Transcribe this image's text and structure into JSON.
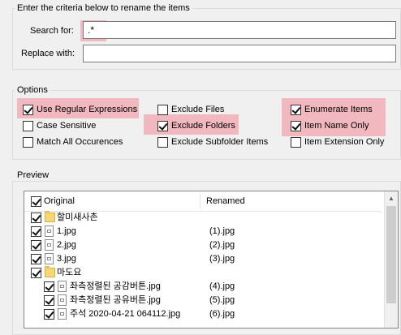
{
  "rename_criteria": {
    "title": "Enter the criteria below to rename the items",
    "search_label": "Search for:",
    "search_value": ".*",
    "replace_label": "Replace with:",
    "replace_value": ""
  },
  "options": {
    "title": "Options",
    "col1": [
      {
        "label": "Use Regular Expressions",
        "checked": true,
        "highlighted": true
      },
      {
        "label": "Case Sensitive",
        "checked": false,
        "highlighted": false
      },
      {
        "label": "Match All Occurences",
        "checked": false,
        "highlighted": false
      }
    ],
    "col2": [
      {
        "label": "Exclude Files",
        "checked": false,
        "highlighted": false
      },
      {
        "label": "Exclude Folders",
        "checked": true,
        "highlighted": true
      },
      {
        "label": "Exclude Subfolder Items",
        "checked": false,
        "highlighted": false
      }
    ],
    "col3": [
      {
        "label": "Enumerate Items",
        "checked": true,
        "highlighted": true
      },
      {
        "label": "Item Name Only",
        "checked": true,
        "highlighted": true
      },
      {
        "label": "Item Extension Only",
        "checked": false,
        "highlighted": false
      }
    ]
  },
  "preview": {
    "title": "Preview",
    "col_original": "Original",
    "col_renamed": "Renamed",
    "header_checked": true,
    "rows": [
      {
        "name": "할미새사촌",
        "renamed": "",
        "type": "folder",
        "indent": 0,
        "checked": true
      },
      {
        "name": "1.jpg",
        "renamed": "(1).jpg",
        "type": "file",
        "indent": 0,
        "checked": true
      },
      {
        "name": "2.jpg",
        "renamed": "(2).jpg",
        "type": "file",
        "indent": 0,
        "checked": true
      },
      {
        "name": "3.jpg",
        "renamed": "(3).jpg",
        "type": "file",
        "indent": 0,
        "checked": true
      },
      {
        "name": "마도요",
        "renamed": "",
        "type": "folder",
        "indent": 0,
        "checked": true
      },
      {
        "name": "좌측정렬된 공감버튼.jpg",
        "renamed": "(4).jpg",
        "type": "file",
        "indent": 1,
        "checked": true
      },
      {
        "name": "좌측정렬된 공유버튼.jpg",
        "renamed": "(5).jpg",
        "type": "file",
        "indent": 1,
        "checked": true
      },
      {
        "name": "주석 2020-04-21 064112.jpg",
        "renamed": "(6).jpg",
        "type": "file",
        "indent": 1,
        "checked": true
      }
    ]
  },
  "colors": {
    "highlight": "#f2b8bf",
    "background": "#f0f0f0",
    "border": "#dcdcdc"
  }
}
